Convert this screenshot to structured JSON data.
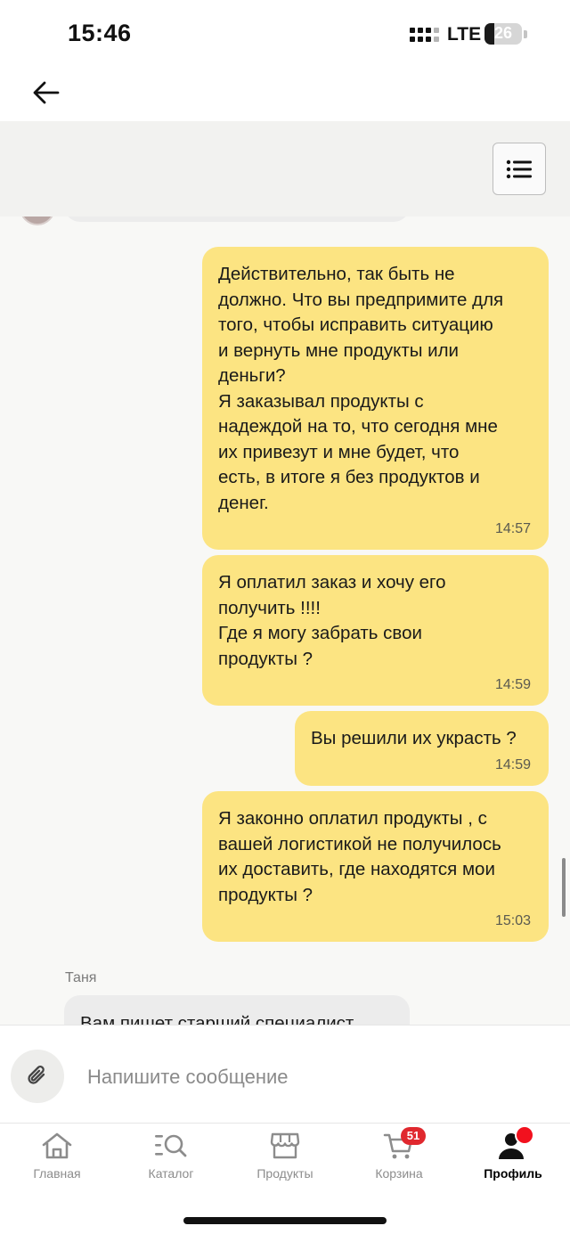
{
  "status_bar": {
    "time": "15:46",
    "network": "LTE",
    "battery": "26",
    "battery_level": 0.26
  },
  "header": {
    "back_icon": "arrow-left-icon",
    "menu_icon": "list-menu-icon"
  },
  "messages": [
    {
      "text": "Действительно, так быть не\nдолжно. Что вы предпримите для\nтого, чтобы исправить ситуацию\nи вернуть мне продукты или\nденьги?\nЯ заказывал продукты с\nнадеждой на то, что сегодня мне\nих привезут и мне будет, что\nесть, в итоге я без продуктов и\nденег.",
      "time": "14:57"
    },
    {
      "text": "Я оплатил заказ и хочу его\nполучить !!!!\nГде я могу забрать свои\nпродукты ?",
      "time": "14:59"
    },
    {
      "text": "Вы решили их украсть ?",
      "time": "14:59"
    },
    {
      "text": "Я законно оплатил продукты , с\nвашей логистикой не получилось\nих доставить, где находятся мои\nпродукты ?",
      "time": "15:03"
    }
  ],
  "incoming": {
    "sender": "Таня",
    "text": "Вам пишет старший специалист"
  },
  "composer": {
    "placeholder": "Напишите сообщение",
    "attach_icon": "paperclip-icon"
  },
  "tabbar": {
    "items": [
      {
        "label": "Главная",
        "icon": "home-icon"
      },
      {
        "label": "Каталог",
        "icon": "catalog-search-icon"
      },
      {
        "label": "Продукты",
        "icon": "store-icon"
      },
      {
        "label": "Корзина",
        "icon": "cart-icon",
        "badge": "51"
      },
      {
        "label": "Профиль",
        "icon": "profile-icon",
        "active": true
      }
    ]
  },
  "colors": {
    "outgoing_bubble": "#fce482",
    "incoming_bubble": "#ececec",
    "badge": "#e0282e",
    "chat_bg": "#f8f8f6"
  }
}
